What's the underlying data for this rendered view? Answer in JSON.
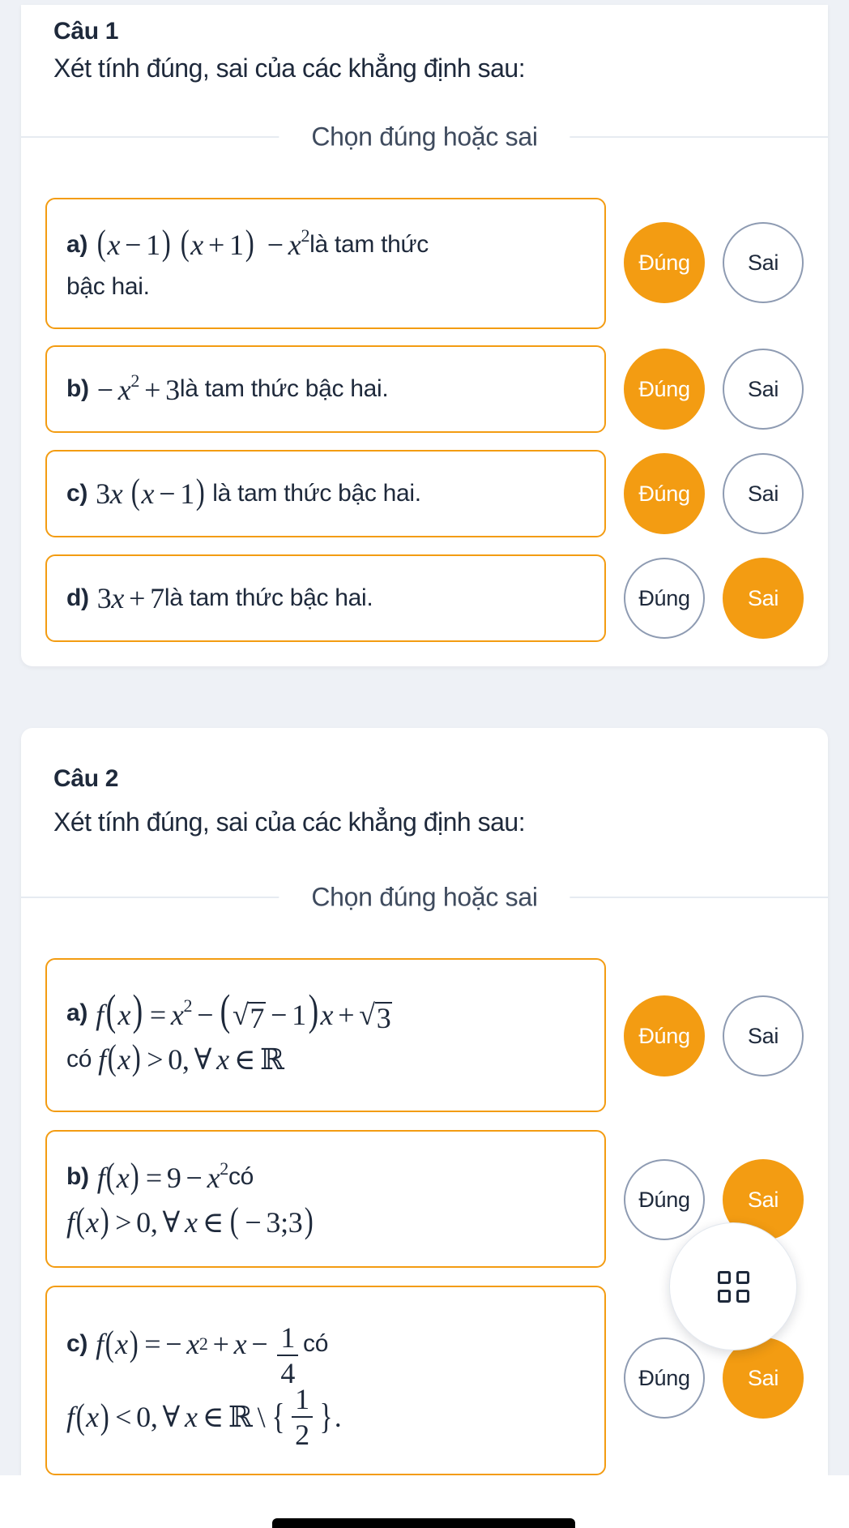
{
  "colors": {
    "accent": "#f39c12",
    "text": "#1e293b",
    "muted": "#3f4b5e",
    "outline": "#8e9bb2",
    "background": "#eef1f6"
  },
  "questions": [
    {
      "title": "Câu 1",
      "prompt": "Xét tính đúng, sai của các khẳng định sau:",
      "section_label": "Chọn đúng hoặc sai",
      "statements": [
        {
          "label": "a)",
          "math": "(x − 1)(x + 1) − x²",
          "text": "là tam thức",
          "text2": "bậc hai.",
          "options": [
            "Đúng",
            "Sai"
          ],
          "selected": "Đúng"
        },
        {
          "label": "b)",
          "math": "−x² + 3",
          "text": "là tam thức bậc hai.",
          "options": [
            "Đúng",
            "Sai"
          ],
          "selected": "Đúng"
        },
        {
          "label": "c)",
          "math": "3x(x − 1)",
          "text": "là tam thức bậc hai.",
          "options": [
            "Đúng",
            "Sai"
          ],
          "selected": "Đúng"
        },
        {
          "label": "d)",
          "math": "3x + 7",
          "text": "là tam thức bậc hai.",
          "options": [
            "Đúng",
            "Sai"
          ],
          "selected": "Sai"
        }
      ]
    },
    {
      "title": "Câu 2",
      "prompt": "Xét tính đúng, sai của các khẳng định sau:",
      "section_label": "Chọn đúng hoặc sai",
      "statements": [
        {
          "label": "a)",
          "math": "f(x) = x² − (√7 − 1)x + √3",
          "connector": "có",
          "math2": "f(x) > 0, ∀x ∈ ℝ",
          "options": [
            "Đúng",
            "Sai"
          ],
          "selected": "Đúng"
        },
        {
          "label": "b)",
          "math": "f(x) = 9 − x²",
          "connector": "có",
          "math2": "f(x) > 0, ∀x ∈ (−3;3)",
          "options": [
            "Đúng",
            "Sai"
          ],
          "selected": "Sai"
        },
        {
          "label": "c)",
          "math": "f(x) = −x² + x − 1/4",
          "connector": "có",
          "math2": "f(x) < 0, ∀x ∈ ℝ \\ {1/2}.",
          "options": [
            "Đúng",
            "Sai"
          ],
          "selected": "Sai"
        }
      ]
    }
  ],
  "fab": {
    "icon": "grid-icon"
  },
  "glyphs": {
    "x": "x",
    "f": "f",
    "minus": "−",
    "plus": "+",
    "eq": "=",
    "gt": ">",
    "lt": "<",
    "one": "1",
    "two": "2",
    "three": "3",
    "four": "4",
    "seven": "7",
    "nine": "9",
    "zero": "0",
    "sq": "2",
    "lp": "(",
    "rp": ")",
    "comma": ",",
    "forall": "∀",
    "in": "∈",
    "reals": "ℝ",
    "radical": "√",
    "setminus": "\\",
    "lbrace": "{",
    "rbrace": "}",
    "semi": ";",
    "dot": "."
  }
}
